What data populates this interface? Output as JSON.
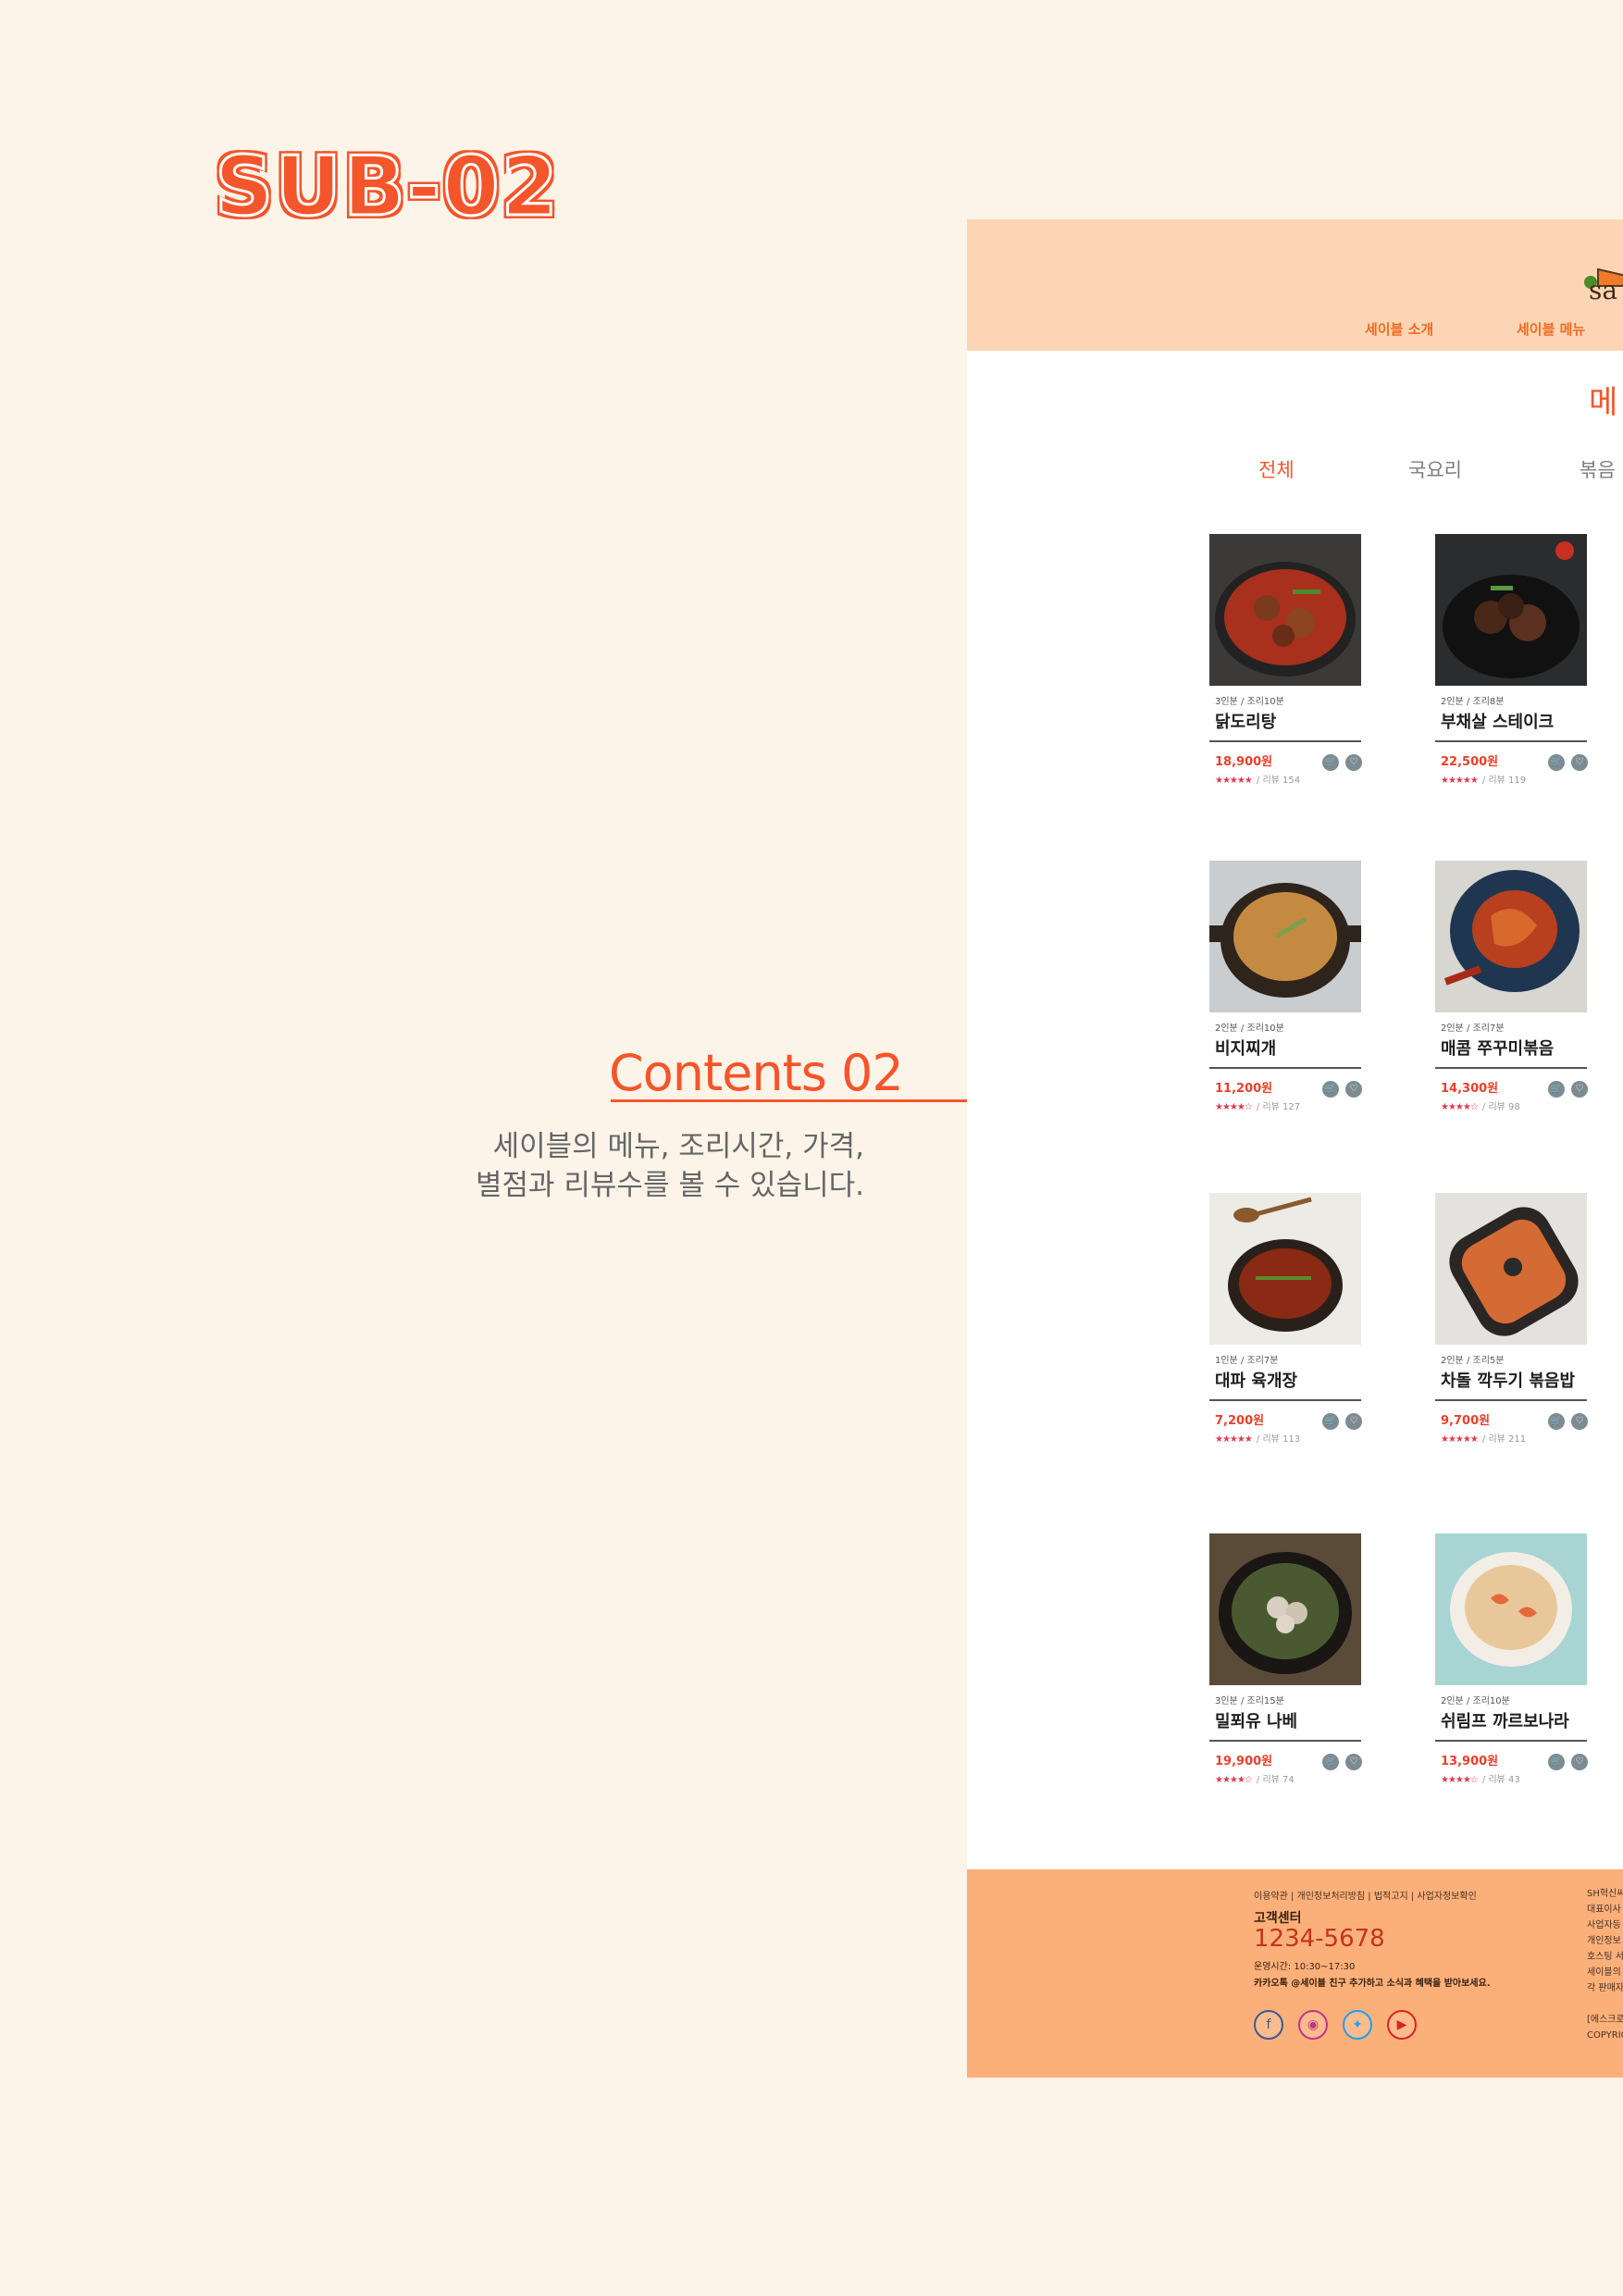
{
  "presentation": {
    "sub_title": "SUB-02",
    "contents_title": "Contents 02",
    "description_lines": [
      "세이블의 메뉴, 조리시간, 가격,",
      "별점과 리뷰수를 볼 수 있습니다."
    ],
    "accent_color": "#f4552a"
  },
  "site": {
    "logo_text": "sa",
    "nav": [
      "세이블 소개",
      "세이블 메뉴"
    ],
    "page_heading": "메",
    "tabs": [
      {
        "label": "전체",
        "active": true
      },
      {
        "label": "국요리",
        "active": false
      },
      {
        "label": "볶음",
        "active": false
      }
    ],
    "products": [
      {
        "servings": "3인분 / 조리10분",
        "name": "닭도리탕",
        "price": "18,900원",
        "stars": "★★★★★",
        "reviews": "/ 리뷰 154",
        "rating": 5
      },
      {
        "servings": "2인분 / 조리8분",
        "name": "부채살 스테이크",
        "price": "22,500원",
        "stars": "★★★★★",
        "reviews": "/ 리뷰 119",
        "rating": 5
      },
      {
        "servings": "2인분 / 조리10분",
        "name": "비지찌개",
        "price": "11,200원",
        "stars": "★★★★☆",
        "reviews": "/ 리뷰 127",
        "rating": 4
      },
      {
        "servings": "2인분 / 조리7분",
        "name": "매콤 쭈꾸미볶음",
        "price": "14,300원",
        "stars": "★★★★☆",
        "reviews": "/ 리뷰 98",
        "rating": 4
      },
      {
        "servings": "1인분 / 조리7분",
        "name": "대파 육개장",
        "price": "7,200원",
        "stars": "★★★★★",
        "reviews": "/ 리뷰 113",
        "rating": 5
      },
      {
        "servings": "2인분 / 조리5분",
        "name": "차돌 깍두기 볶음밥",
        "price": "9,700원",
        "stars": "★★★★★",
        "reviews": "/ 리뷰 211",
        "rating": 5
      },
      {
        "servings": "3인분 / 조리15분",
        "name": "밀푀유 나베",
        "price": "19,900원",
        "stars": "★★★★☆",
        "reviews": "/ 리뷰 74",
        "rating": 4
      },
      {
        "servings": "2인분 / 조리10분",
        "name": "쉬림프 까르보나라",
        "price": "13,900원",
        "stars": "★★★★☆",
        "reviews": "/ 리뷰 43",
        "rating": 4
      }
    ],
    "footer": {
      "links": "이용약관 | 개인정보처리방침 | 법적고지 | 사업자정보확인",
      "cs_label": "고객센터",
      "phone": "1234-5678",
      "hours": "운영시간: 10:30~17:30",
      "kakao": "카카오톡 @세이블 친구 추가하고 소식과 혜택을 받아보세요.",
      "company_lines": [
        "SH혁신씨",
        "대표이사",
        "사업자등",
        "개인정보",
        "호스팅 서",
        "세이블의",
        "각 판매자",
        "",
        "[에스크로",
        "COPYRIG"
      ]
    },
    "socials": [
      "facebook-icon",
      "instagram-icon",
      "twitter-icon",
      "youtube-icon"
    ]
  }
}
